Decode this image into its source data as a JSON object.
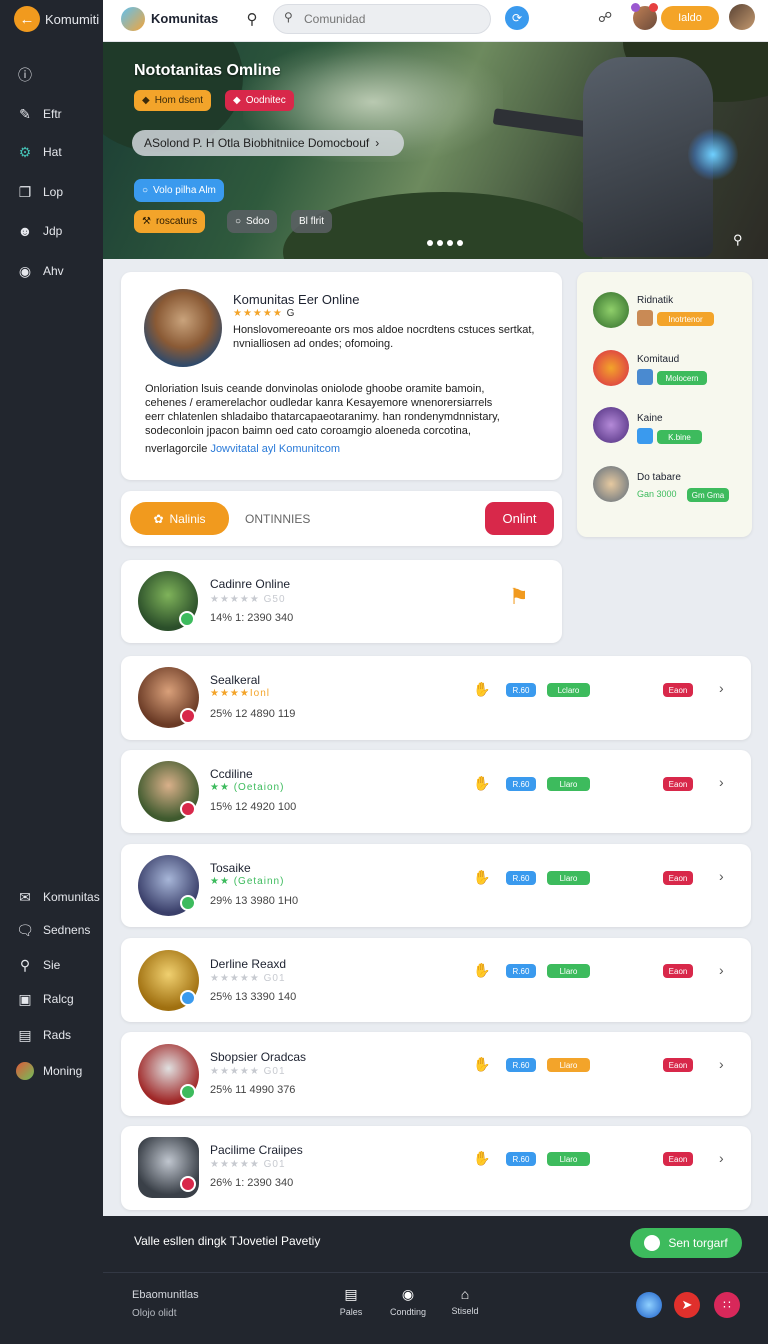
{
  "sidebar": {
    "brand": "Komumiti",
    "items": [
      {
        "label": "",
        "icon": "info-icon"
      },
      {
        "label": "Eftr",
        "icon": "edit-icon"
      },
      {
        "label": "Hat",
        "icon": "gear-icon"
      },
      {
        "label": "Lop",
        "icon": "layers-icon"
      },
      {
        "label": "Jdp",
        "icon": "user-icon"
      },
      {
        "label": "Ahv",
        "icon": "globe-icon"
      }
    ],
    "bottom_items": [
      {
        "label": "Komunitas",
        "icon": "mail-icon"
      },
      {
        "label": "Sednens",
        "icon": "chat-icon"
      },
      {
        "label": "Sie",
        "icon": "headset-icon"
      },
      {
        "label": "Ralcg",
        "icon": "gamepad-icon"
      },
      {
        "label": "Rads",
        "icon": "book-icon"
      },
      {
        "label": "Moning",
        "icon": "avatar-icon"
      }
    ]
  },
  "topbar": {
    "title": "Komunitas",
    "search_placeholder": "Comunidad",
    "pill_label": "Ialdo"
  },
  "hero": {
    "title": "Nototanitas Omline",
    "chip1": "Hom dsent",
    "chip2": "Oodnitec",
    "banner": "ASolond P. H Otla Biobhitniice Domocbouf",
    "status": "Volo pilha Alm",
    "chip3": "roscaturs",
    "chip4": "Sdoo",
    "chip5": "Bl flrit"
  },
  "profile": {
    "name": "Komunitas Eer Online",
    "rating_text": "G",
    "subtitle_1": "Honslovomereoante ors mos aldoe nocrdtens cstuces sertkat,",
    "subtitle_2": "nvnialliosen ad ondes; ofomoing.",
    "body": [
      "Onloriation lsuis ceande donvinolas oniolode ghoobe oramite bamoin,",
      "cehenes / eramerelachor oudledar kanra Kesayemore wnenorersiarrels",
      "eerr chlatenlen shladaibo thatarcapaeotaranimy. han rondenymdnnistary,",
      "sodeconloin jpacon baimn oed cato coroamgio aloeneda corcotina,"
    ],
    "link_prefix": "nverlagorcile",
    "link": "Jowvitatal ayl Komunitcom"
  },
  "tabs": {
    "active": "Nalinis",
    "inactive": "ONTINNIES",
    "right": "Onlint"
  },
  "right_panel": [
    {
      "name": "Ridnatik",
      "badge": "Inotrtenor"
    },
    {
      "name": "Komitaud",
      "badge": "Molocern"
    },
    {
      "name": "Kaine",
      "badge": "K.bine"
    },
    {
      "name": "Do tabare",
      "meta": "Gan 3000",
      "badge": "Gm Gma"
    }
  ],
  "games": [
    {
      "title": "Cadinre Online",
      "rating": "G50",
      "meta": "14% 1: 2390 340"
    },
    {
      "title": "Sealkeral",
      "rating": "Ionl",
      "meta": "25% 12 4890 119",
      "b1": "R.60",
      "b2": "Lclaro",
      "b3": "Eaon"
    },
    {
      "title": "Ccdiline",
      "rating": "(Oetaion)",
      "meta": "15% 12 4920 100",
      "b1": "R.60",
      "b2": "Llaro",
      "b3": "Eaon"
    },
    {
      "title": "Tosaike",
      "rating": "(Getainn)",
      "meta": "29% 13 3980 1H0",
      "b1": "R.60",
      "b2": "Llaro",
      "b3": "Eaon"
    },
    {
      "title": "Derline Reaxd",
      "rating": "G01",
      "meta": "25% 13 3390 140",
      "b1": "R.60",
      "b2": "Llaro",
      "b3": "Eaon"
    },
    {
      "title": "Sbopsier Oradcas",
      "rating": "G01",
      "meta": "25% 11 4990 376",
      "b1": "R.60",
      "b2": "Llaro",
      "b3": "Eaon"
    },
    {
      "title": "Pacilime Craiipes",
      "rating": "G01",
      "meta": "26% 1: 2390 340",
      "b1": "R.60",
      "b2": "Llaro",
      "b3": "Eaon"
    }
  ],
  "promo": {
    "text": "Valle esllen dingk TJovetiel Pavetiy",
    "button": "Sen torgarf"
  },
  "footer": {
    "line1": "Ebaomunitlas",
    "line2": "Olojo olidt",
    "nav": [
      {
        "label": "Pales"
      },
      {
        "label": "Condting"
      },
      {
        "label": "Stiseld"
      }
    ]
  },
  "colors": {
    "accent": "#f19a1e",
    "sidebar": "#22262e",
    "green": "#3dbb5d",
    "blue": "#3a9aee",
    "red": "#d8284a"
  }
}
